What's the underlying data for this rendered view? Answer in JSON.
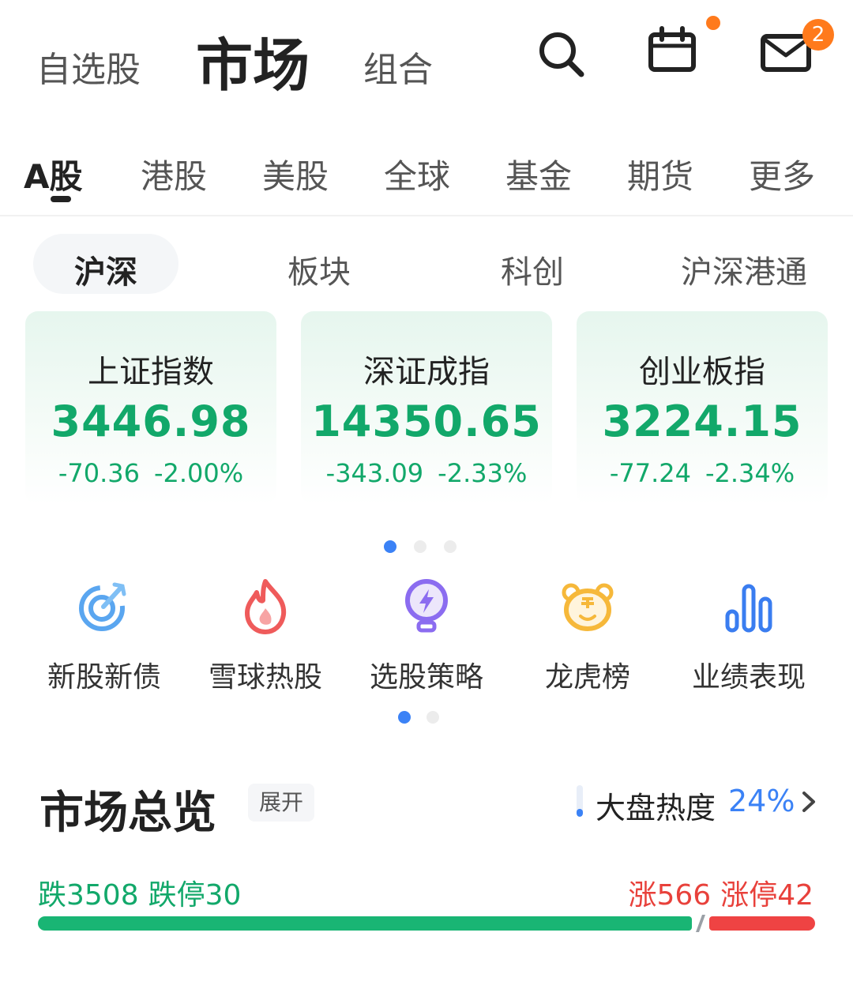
{
  "header": {
    "tabs": [
      "自选股",
      "市场",
      "组合"
    ],
    "active_tab": 1,
    "mail_badge": "2",
    "icons": [
      "search-icon",
      "calendar-icon",
      "mail-icon"
    ]
  },
  "market_tabs": {
    "items": [
      "A股",
      "港股",
      "美股",
      "全球",
      "基金",
      "期货",
      "更多"
    ],
    "active": 0
  },
  "sub_tabs": {
    "items": [
      "沪深",
      "板块",
      "科创",
      "沪深港通"
    ],
    "active": 0
  },
  "indices": [
    {
      "name": "上证指数",
      "value": "3446.98",
      "change": "-70.36",
      "pct": "-2.00%"
    },
    {
      "name": "深证成指",
      "value": "14350.65",
      "change": "-343.09",
      "pct": "-2.33%"
    },
    {
      "name": "创业板指",
      "value": "3224.15",
      "change": "-77.24",
      "pct": "-2.34%"
    }
  ],
  "index_pager": {
    "count": 3,
    "active": 0
  },
  "quick_entries": [
    {
      "label": "新股新债",
      "icon": "target-icon"
    },
    {
      "label": "雪球热股",
      "icon": "flame-icon"
    },
    {
      "label": "选股策略",
      "icon": "lightbulb-icon"
    },
    {
      "label": "龙虎榜",
      "icon": "tiger-icon"
    },
    {
      "label": "业绩表现",
      "icon": "bar-chart-icon"
    }
  ],
  "quick_pager": {
    "count": 2,
    "active": 0
  },
  "overview": {
    "title": "市场总览",
    "expand_label": "展开",
    "heat_label": "大盘热度",
    "heat_value": "24%",
    "heat_fraction": 0.24,
    "down_label": "跌3508",
    "limit_down_label": "跌停30",
    "up_label": "涨566",
    "limit_up_label": "涨停42",
    "down_count": 3508,
    "up_count": 566
  },
  "colors": {
    "down_green": "#12a86a",
    "up_red": "#e8413b",
    "accent_blue": "#3b82f6",
    "badge_orange": "#ff7a1c"
  }
}
